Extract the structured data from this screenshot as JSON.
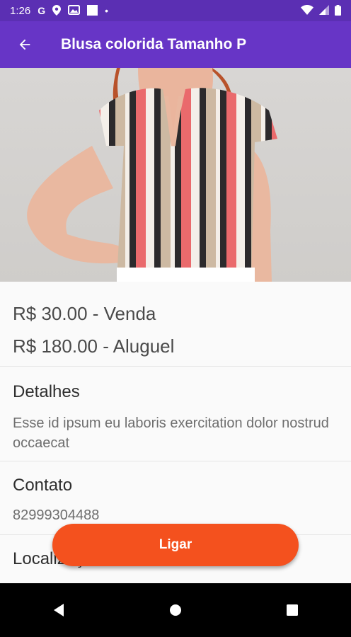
{
  "status_bar": {
    "time": "1:26",
    "g_icon": "G",
    "dot": "•"
  },
  "app_bar": {
    "title": "Blusa colorida Tamanho P"
  },
  "product": {
    "image": "striped-blouse-photo",
    "price_sale": "R$ 30.00 - Venda",
    "price_rent": "R$ 180.00 - Aluguel"
  },
  "details": {
    "heading": "Detalhes",
    "text": "Esse id ipsum eu laboris exercitation dolor nostrud occaecat"
  },
  "contact": {
    "heading": "Contato",
    "phone": "82999304488"
  },
  "location": {
    "heading": "Localização"
  },
  "call_button": {
    "label": "Ligar"
  },
  "colors": {
    "status_bar": "#5b2fb3",
    "app_bar": "#6735c6",
    "accent": "#f4511e"
  }
}
